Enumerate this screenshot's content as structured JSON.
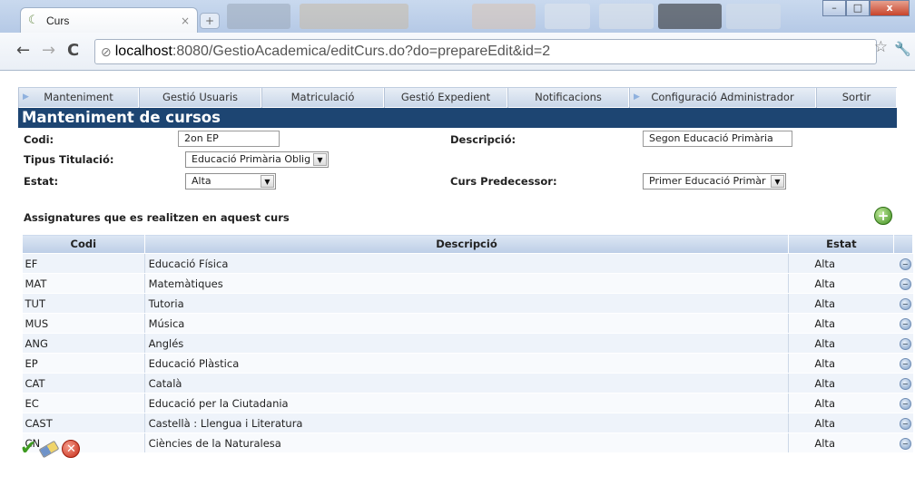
{
  "browser": {
    "tab_title": "Curs",
    "url_host": "localhost",
    "url_path": ":8080/GestioAcademica/editCurs.do?do=prepareEdit&id=2",
    "window_buttons": [
      "–",
      "□",
      "x"
    ]
  },
  "menu": [
    {
      "label": "Manteniment",
      "has_arrow": true
    },
    {
      "label": "Gestió Usuaris",
      "has_arrow": false
    },
    {
      "label": "Matriculació",
      "has_arrow": false
    },
    {
      "label": "Gestió Expedient",
      "has_arrow": false
    },
    {
      "label": "Notificacions",
      "has_arrow": false
    },
    {
      "label": "Configuració Administrador",
      "has_arrow": true
    },
    {
      "label": "Sortir",
      "has_arrow": false
    }
  ],
  "page_title": "Manteniment de cursos",
  "form": {
    "codi_label": "Codi:",
    "codi_value": "2on EP",
    "descripcio_label": "Descripció:",
    "descripcio_value": "Segon Educació Primària",
    "tipus_label": "Tipus Titulació:",
    "tipus_value": "Educació Primària Oblig",
    "estat_label": "Estat:",
    "estat_value": "Alta",
    "predecessor_label": "Curs Predecessor:",
    "predecessor_value": "Primer Educació Primàr"
  },
  "subjects": {
    "section_title": "Assignatures que es realitzen en aquest curs",
    "columns": [
      "Codi",
      "Descripció",
      "Estat"
    ],
    "rows": [
      {
        "codi": "EF",
        "descripcio": "Educació Física",
        "estat": "Alta"
      },
      {
        "codi": "MAT",
        "descripcio": "Matemàtiques",
        "estat": "Alta"
      },
      {
        "codi": "TUT",
        "descripcio": "Tutoria",
        "estat": "Alta"
      },
      {
        "codi": "MUS",
        "descripcio": "Música",
        "estat": "Alta"
      },
      {
        "codi": "ANG",
        "descripcio": "Anglés",
        "estat": "Alta"
      },
      {
        "codi": "EP",
        "descripcio": "Educació Plàstica",
        "estat": "Alta"
      },
      {
        "codi": "CAT",
        "descripcio": "Català",
        "estat": "Alta"
      },
      {
        "codi": "EC",
        "descripcio": "Educació per la Ciutadania",
        "estat": "Alta"
      },
      {
        "codi": "CAST",
        "descripcio": "Castellà : Llengua i Literatura",
        "estat": "Alta"
      },
      {
        "codi": "CN",
        "descripcio": "Ciències de la Naturalesa",
        "estat": "Alta"
      }
    ]
  },
  "colors": {
    "banner": "#1d4572",
    "accent_green": "#3d9a1f",
    "cancel_red": "#c52a16"
  }
}
